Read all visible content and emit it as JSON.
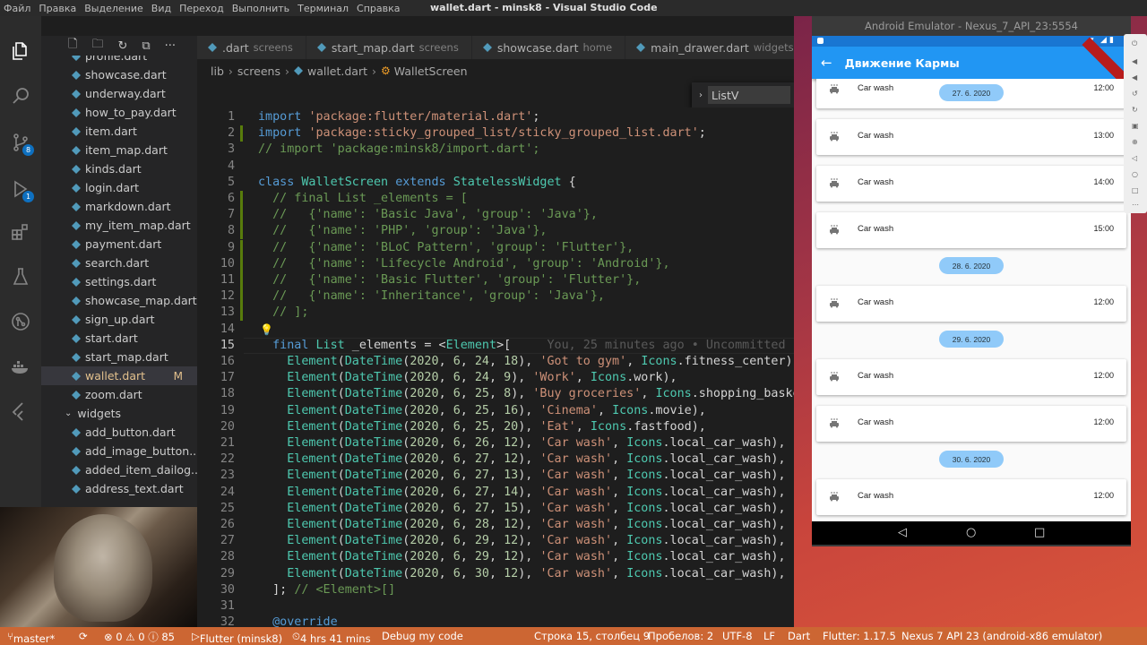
{
  "window": {
    "title": "wallet.dart - minsk8 - Visual Studio Code",
    "menu": [
      "Файл",
      "Правка",
      "Выделение",
      "Вид",
      "Переход",
      "Выполнить",
      "Терминал",
      "Справка"
    ]
  },
  "activity": {
    "scm_badge": "8",
    "debug_badge": "1"
  },
  "explorer": {
    "files": [
      {
        "name": "profile.dart",
        "color": "#519aba"
      },
      {
        "name": "showcase.dart",
        "color": "#519aba"
      },
      {
        "name": "underway.dart",
        "color": "#519aba"
      },
      {
        "name": "how_to_pay.dart",
        "color": "#519aba"
      },
      {
        "name": "item.dart",
        "color": "#519aba"
      },
      {
        "name": "item_map.dart",
        "color": "#519aba"
      },
      {
        "name": "kinds.dart",
        "color": "#519aba"
      },
      {
        "name": "login.dart",
        "color": "#519aba"
      },
      {
        "name": "markdown.dart",
        "color": "#519aba"
      },
      {
        "name": "my_item_map.dart",
        "color": "#519aba"
      },
      {
        "name": "payment.dart",
        "color": "#519aba"
      },
      {
        "name": "search.dart",
        "color": "#519aba"
      },
      {
        "name": "settings.dart",
        "color": "#519aba"
      },
      {
        "name": "showcase_map.dart",
        "color": "#519aba"
      },
      {
        "name": "sign_up.dart",
        "color": "#519aba"
      },
      {
        "name": "start.dart",
        "color": "#519aba"
      },
      {
        "name": "start_map.dart",
        "color": "#519aba"
      },
      {
        "name": "wallet.dart",
        "color": "#519aba",
        "selected": true,
        "mod": "M"
      },
      {
        "name": "zoom.dart",
        "color": "#519aba"
      },
      {
        "name": "widgets",
        "folder": true
      },
      {
        "name": "add_button.dart",
        "color": "#519aba"
      },
      {
        "name": "add_image_button....",
        "color": "#519aba"
      },
      {
        "name": "added_item_dailog....",
        "color": "#519aba"
      },
      {
        "name": "address_text.dart",
        "color": "#519aba"
      }
    ]
  },
  "tabs": [
    {
      "name": ".dart",
      "sub": "screens"
    },
    {
      "name": "start_map.dart",
      "sub": "screens"
    },
    {
      "name": "showcase.dart",
      "sub": "home"
    },
    {
      "name": "main_drawer.dart",
      "sub": "widgets"
    }
  ],
  "breadcrumb": {
    "parts": [
      "lib",
      "screens",
      "wallet.dart"
    ],
    "symbol": "WalletScreen"
  },
  "find": {
    "value": "ListV"
  },
  "code": [
    {
      "n": "1",
      "html": "<span class=\"kw\">import</span> <span class=\"str\">'package:flutter/material.dart'</span>;"
    },
    {
      "n": "2",
      "html": "<span class=\"kw\">import</span> <span class=\"str\">'package:sticky_grouped_list/sticky_grouped_list.dart'</span>;",
      "g": true
    },
    {
      "n": "3",
      "html": "<span class=\"cmt\">// import 'package:minsk8/import.dart';</span>"
    },
    {
      "n": "4",
      "html": ""
    },
    {
      "n": "5",
      "html": "<span class=\"kw\">class</span> <span class=\"typ\">WalletScreen</span> <span class=\"kw\">extends</span> <span class=\"typ\">StatelessWidget</span> {"
    },
    {
      "n": "6",
      "html": "  <span class=\"cmt\">// final List _elements = [</span>",
      "g": true
    },
    {
      "n": "7",
      "html": "  <span class=\"cmt\">//   {'name': 'Basic Java', 'group': 'Java'},</span>",
      "g": true
    },
    {
      "n": "8",
      "html": "  <span class=\"cmt\">//   {'name': 'PHP', 'group': 'Java'},</span>",
      "g": true
    },
    {
      "n": "9",
      "html": "  <span class=\"cmt\">//   {'name': 'BLoC Pattern', 'group': 'Flutter'},</span>",
      "g": true
    },
    {
      "n": "10",
      "html": "  <span class=\"cmt\">//   {'name': 'Lifecycle Android', 'group': 'Android'},</span>",
      "g": true
    },
    {
      "n": "11",
      "html": "  <span class=\"cmt\">//   {'name': 'Basic Flutter', 'group': 'Flutter'},</span>",
      "g": true
    },
    {
      "n": "12",
      "html": "  <span class=\"cmt\">//   {'name': 'Inheritance', 'group': 'Java'},</span>",
      "g": true
    },
    {
      "n": "13",
      "html": "  <span class=\"cmt\">// ];</span>",
      "g": true
    },
    {
      "n": "14",
      "html": "",
      "bulb": true
    },
    {
      "n": "15",
      "html": "  <span class=\"kw\">final</span> <span class=\"typ\">List</span> _elements = &lt;<span class=\"typ\">Element</span>&gt;[     <span class=\"blame\">You, 25 minutes ago • Uncommitted</span>",
      "cur": true
    },
    {
      "n": "16",
      "html": "    <span class=\"typ\">Element</span>(<span class=\"typ\">DateTime</span>(<span class=\"num\">2020</span>, <span class=\"num\">6</span>, <span class=\"num\">24</span>, <span class=\"num\">18</span>), <span class=\"str\">'Got to gym'</span>, <span class=\"typ\">Icons</span>.fitness_center),"
    },
    {
      "n": "17",
      "html": "    <span class=\"typ\">Element</span>(<span class=\"typ\">DateTime</span>(<span class=\"num\">2020</span>, <span class=\"num\">6</span>, <span class=\"num\">24</span>, <span class=\"num\">9</span>), <span class=\"str\">'Work'</span>, <span class=\"typ\">Icons</span>.work),"
    },
    {
      "n": "18",
      "html": "    <span class=\"typ\">Element</span>(<span class=\"typ\">DateTime</span>(<span class=\"num\">2020</span>, <span class=\"num\">6</span>, <span class=\"num\">25</span>, <span class=\"num\">8</span>), <span class=\"str\">'Buy groceries'</span>, <span class=\"typ\">Icons</span>.shopping_baske"
    },
    {
      "n": "19",
      "html": "    <span class=\"typ\">Element</span>(<span class=\"typ\">DateTime</span>(<span class=\"num\">2020</span>, <span class=\"num\">6</span>, <span class=\"num\">25</span>, <span class=\"num\">16</span>), <span class=\"str\">'Cinema'</span>, <span class=\"typ\">Icons</span>.movie),"
    },
    {
      "n": "20",
      "html": "    <span class=\"typ\">Element</span>(<span class=\"typ\">DateTime</span>(<span class=\"num\">2020</span>, <span class=\"num\">6</span>, <span class=\"num\">25</span>, <span class=\"num\">20</span>), <span class=\"str\">'Eat'</span>, <span class=\"typ\">Icons</span>.fastfood),"
    },
    {
      "n": "21",
      "html": "    <span class=\"typ\">Element</span>(<span class=\"typ\">DateTime</span>(<span class=\"num\">2020</span>, <span class=\"num\">6</span>, <span class=\"num\">26</span>, <span class=\"num\">12</span>), <span class=\"str\">'Car wash'</span>, <span class=\"typ\">Icons</span>.local_car_wash),"
    },
    {
      "n": "22",
      "html": "    <span class=\"typ\">Element</span>(<span class=\"typ\">DateTime</span>(<span class=\"num\">2020</span>, <span class=\"num\">6</span>, <span class=\"num\">27</span>, <span class=\"num\">12</span>), <span class=\"str\">'Car wash'</span>, <span class=\"typ\">Icons</span>.local_car_wash),"
    },
    {
      "n": "23",
      "html": "    <span class=\"typ\">Element</span>(<span class=\"typ\">DateTime</span>(<span class=\"num\">2020</span>, <span class=\"num\">6</span>, <span class=\"num\">27</span>, <span class=\"num\">13</span>), <span class=\"str\">'Car wash'</span>, <span class=\"typ\">Icons</span>.local_car_wash),"
    },
    {
      "n": "24",
      "html": "    <span class=\"typ\">Element</span>(<span class=\"typ\">DateTime</span>(<span class=\"num\">2020</span>, <span class=\"num\">6</span>, <span class=\"num\">27</span>, <span class=\"num\">14</span>), <span class=\"str\">'Car wash'</span>, <span class=\"typ\">Icons</span>.local_car_wash),"
    },
    {
      "n": "25",
      "html": "    <span class=\"typ\">Element</span>(<span class=\"typ\">DateTime</span>(<span class=\"num\">2020</span>, <span class=\"num\">6</span>, <span class=\"num\">27</span>, <span class=\"num\">15</span>), <span class=\"str\">'Car wash'</span>, <span class=\"typ\">Icons</span>.local_car_wash),"
    },
    {
      "n": "26",
      "html": "    <span class=\"typ\">Element</span>(<span class=\"typ\">DateTime</span>(<span class=\"num\">2020</span>, <span class=\"num\">6</span>, <span class=\"num\">28</span>, <span class=\"num\">12</span>), <span class=\"str\">'Car wash'</span>, <span class=\"typ\">Icons</span>.local_car_wash),"
    },
    {
      "n": "27",
      "html": "    <span class=\"typ\">Element</span>(<span class=\"typ\">DateTime</span>(<span class=\"num\">2020</span>, <span class=\"num\">6</span>, <span class=\"num\">29</span>, <span class=\"num\">12</span>), <span class=\"str\">'Car wash'</span>, <span class=\"typ\">Icons</span>.local_car_wash),"
    },
    {
      "n": "28",
      "html": "    <span class=\"typ\">Element</span>(<span class=\"typ\">DateTime</span>(<span class=\"num\">2020</span>, <span class=\"num\">6</span>, <span class=\"num\">29</span>, <span class=\"num\">12</span>), <span class=\"str\">'Car wash'</span>, <span class=\"typ\">Icons</span>.local_car_wash),"
    },
    {
      "n": "29",
      "html": "    <span class=\"typ\">Element</span>(<span class=\"typ\">DateTime</span>(<span class=\"num\">2020</span>, <span class=\"num\">6</span>, <span class=\"num\">30</span>, <span class=\"num\">12</span>), <span class=\"str\">'Car wash'</span>, <span class=\"typ\">Icons</span>.local_car_wash),"
    },
    {
      "n": "30",
      "html": "  ]; <span class=\"cmt\">// &lt;Element&gt;[]</span>"
    },
    {
      "n": "31",
      "html": ""
    },
    {
      "n": "32",
      "html": "  <span class=\"kw\">@override</span>"
    }
  ],
  "status": {
    "branch": "master*",
    "problems": "⊗ 0 ⚠ 0 ⓘ 85",
    "flutter": "Flutter (minsk8)",
    "time": "4 hrs 41 mins",
    "debug": "Debug my code",
    "position": "Строка 15, столбец 9",
    "spaces": "Пробелов: 2",
    "encoding": "UTF-8",
    "eol": "LF",
    "lang": "Dart",
    "flutter_ver": "Flutter: 1.17.5",
    "device": "Nexus 7 API 23 (android-x86 emulator)"
  },
  "emulator": {
    "title": "Android Emulator - Nexus_7_API_23:5554",
    "app_title": "Движение Кармы",
    "items": [
      {
        "type": "card",
        "label": "Car wash",
        "time": "12:00",
        "pill": "27. 6. 2020"
      },
      {
        "type": "card",
        "label": "Car wash",
        "time": "13:00"
      },
      {
        "type": "card",
        "label": "Car wash",
        "time": "14:00"
      },
      {
        "type": "card",
        "label": "Car wash",
        "time": "15:00"
      },
      {
        "type": "pill",
        "label": "28. 6. 2020"
      },
      {
        "type": "card",
        "label": "Car wash",
        "time": "12:00"
      },
      {
        "type": "pill",
        "label": "29. 6. 2020"
      },
      {
        "type": "card",
        "label": "Car wash",
        "time": "12:00"
      },
      {
        "type": "card",
        "label": "Car wash",
        "time": "12:00"
      },
      {
        "type": "pill",
        "label": "30. 6. 2020"
      },
      {
        "type": "card",
        "label": "Car wash",
        "time": "12:00"
      }
    ]
  }
}
